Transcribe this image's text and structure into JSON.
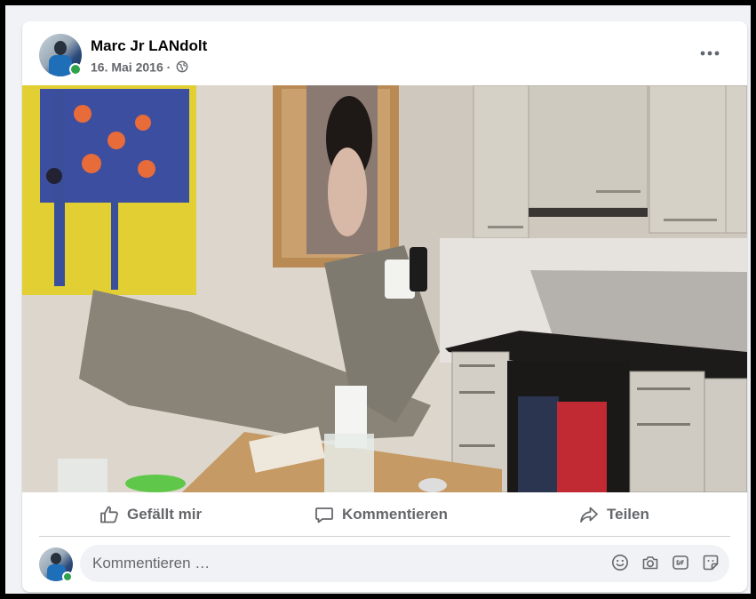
{
  "post": {
    "author": "Marc Jr LANdolt",
    "date": "16. Mai 2016",
    "separator": "·",
    "privacy_icon": "globe-icon",
    "menu_icon": "more-options-icon",
    "photo_description_icon": "post-photo"
  },
  "actions": {
    "like_label": "Gefällt mir",
    "comment_label": "Kommentieren",
    "share_label": "Teilen"
  },
  "comment_box": {
    "placeholder": "Kommentieren …",
    "icons": [
      "emoji-icon",
      "camera-icon",
      "gif-icon",
      "sticker-icon"
    ]
  },
  "colors": {
    "secondary_text": "#65676b",
    "online": "#31a24c",
    "input_bg": "#f0f2f5"
  }
}
